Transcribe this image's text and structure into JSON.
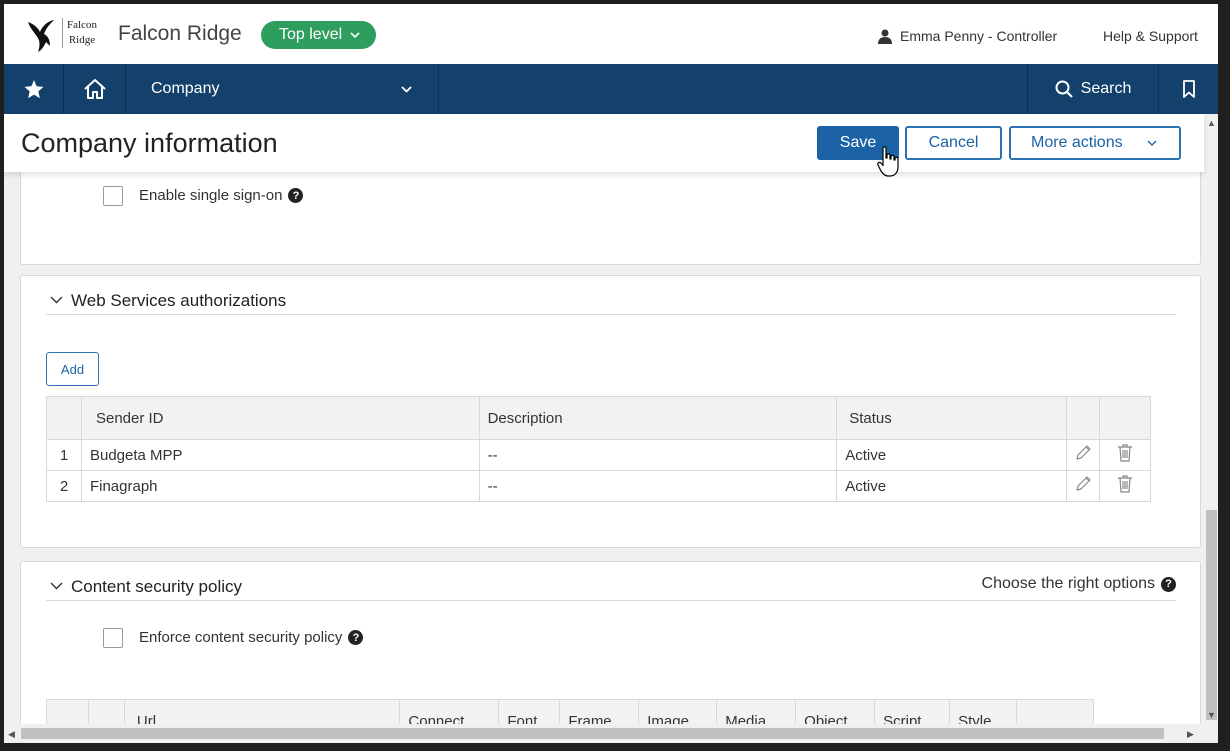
{
  "header": {
    "logo_line1": "Falcon",
    "logo_line2": "Ridge",
    "company_name": "Falcon Ridge",
    "level_label": "Top level",
    "user_label": "Emma Penny - Controller",
    "help_label": "Help & Support"
  },
  "nav": {
    "company_label": "Company",
    "search_label": "Search"
  },
  "page": {
    "title": "Company information",
    "save_label": "Save",
    "cancel_label": "Cancel",
    "more_actions_label": "More actions"
  },
  "sso": {
    "label": "Enable single sign-on"
  },
  "web_services": {
    "title": "Web Services authorizations",
    "add_label": "Add",
    "columns": [
      "Sender ID",
      "Description",
      "Status"
    ],
    "rows": [
      {
        "num": "1",
        "sender_id": "Budgeta MPP",
        "description": "--",
        "status": "Active"
      },
      {
        "num": "2",
        "sender_id": "Finagraph",
        "description": "--",
        "status": "Active"
      }
    ]
  },
  "csp": {
    "title": "Content security policy",
    "help_label": "Choose the right options",
    "enforce_label": "Enforce content security policy",
    "columns": [
      "Url",
      "Connect",
      "Font",
      "Frame",
      "Image",
      "Media",
      "Object",
      "Script",
      "Style"
    ]
  },
  "colors": {
    "nav_bg": "#14406c",
    "level_pill": "#2e9e5e",
    "primary": "#1b63a6"
  }
}
